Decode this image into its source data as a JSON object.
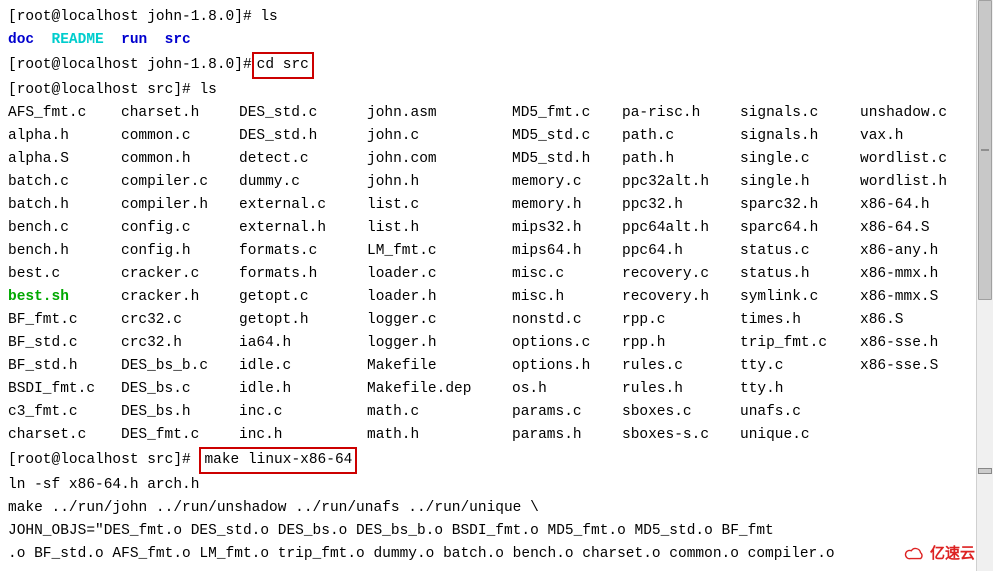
{
  "prompt1": "[root@localhost john-1.8.0]# ",
  "cmd_ls1": "ls",
  "dirline": {
    "doc": "doc",
    "readme": "README",
    "run": "run",
    "src": "src"
  },
  "prompt2": "[root@localhost john-1.8.0]#",
  "cmd_cd": " cd src      ",
  "prompt3": "[root@localhost src]# ",
  "cmd_ls2": "ls",
  "cols": [
    [
      {
        "t": "AFS_fmt.c"
      },
      {
        "t": "alpha.h"
      },
      {
        "t": "alpha.S"
      },
      {
        "t": "batch.c"
      },
      {
        "t": "batch.h"
      },
      {
        "t": "bench.c"
      },
      {
        "t": "bench.h"
      },
      {
        "t": "best.c"
      },
      {
        "t": "best.sh",
        "cls": "green"
      },
      {
        "t": "BF_fmt.c"
      },
      {
        "t": "BF_std.c"
      },
      {
        "t": "BF_std.h"
      },
      {
        "t": "BSDI_fmt.c"
      },
      {
        "t": "c3_fmt.c"
      },
      {
        "t": "charset.c"
      }
    ],
    [
      {
        "t": "charset.h"
      },
      {
        "t": "common.c"
      },
      {
        "t": "common.h"
      },
      {
        "t": "compiler.c"
      },
      {
        "t": "compiler.h"
      },
      {
        "t": "config.c"
      },
      {
        "t": "config.h"
      },
      {
        "t": "cracker.c"
      },
      {
        "t": "cracker.h"
      },
      {
        "t": "crc32.c"
      },
      {
        "t": "crc32.h"
      },
      {
        "t": "DES_bs_b.c"
      },
      {
        "t": "DES_bs.c"
      },
      {
        "t": "DES_bs.h"
      },
      {
        "t": "DES_fmt.c"
      }
    ],
    [
      {
        "t": "DES_std.c"
      },
      {
        "t": "DES_std.h"
      },
      {
        "t": "detect.c"
      },
      {
        "t": "dummy.c"
      },
      {
        "t": "external.c"
      },
      {
        "t": "external.h"
      },
      {
        "t": "formats.c"
      },
      {
        "t": "formats.h"
      },
      {
        "t": "getopt.c"
      },
      {
        "t": "getopt.h"
      },
      {
        "t": "ia64.h"
      },
      {
        "t": "idle.c"
      },
      {
        "t": "idle.h"
      },
      {
        "t": "inc.c"
      },
      {
        "t": "inc.h"
      }
    ],
    [
      {
        "t": "john.asm"
      },
      {
        "t": "john.c"
      },
      {
        "t": "john.com"
      },
      {
        "t": "john.h"
      },
      {
        "t": "list.c"
      },
      {
        "t": "list.h"
      },
      {
        "t": "LM_fmt.c"
      },
      {
        "t": "loader.c"
      },
      {
        "t": "loader.h"
      },
      {
        "t": "logger.c"
      },
      {
        "t": "logger.h"
      },
      {
        "t": "Makefile"
      },
      {
        "t": "Makefile.dep"
      },
      {
        "t": "math.c"
      },
      {
        "t": "math.h"
      }
    ],
    [
      {
        "t": "MD5_fmt.c"
      },
      {
        "t": "MD5_std.c"
      },
      {
        "t": "MD5_std.h"
      },
      {
        "t": "memory.c"
      },
      {
        "t": "memory.h"
      },
      {
        "t": "mips32.h"
      },
      {
        "t": "mips64.h"
      },
      {
        "t": "misc.c"
      },
      {
        "t": "misc.h"
      },
      {
        "t": "nonstd.c"
      },
      {
        "t": "options.c"
      },
      {
        "t": "options.h"
      },
      {
        "t": "os.h"
      },
      {
        "t": "params.c"
      },
      {
        "t": "params.h"
      }
    ],
    [
      {
        "t": "pa-risc.h"
      },
      {
        "t": "path.c"
      },
      {
        "t": "path.h"
      },
      {
        "t": "ppc32alt.h"
      },
      {
        "t": "ppc32.h"
      },
      {
        "t": "ppc64alt.h"
      },
      {
        "t": "ppc64.h"
      },
      {
        "t": "recovery.c"
      },
      {
        "t": "recovery.h"
      },
      {
        "t": "rpp.c"
      },
      {
        "t": "rpp.h"
      },
      {
        "t": "rules.c"
      },
      {
        "t": "rules.h"
      },
      {
        "t": "sboxes.c"
      },
      {
        "t": "sboxes-s.c"
      }
    ],
    [
      {
        "t": "signals.c"
      },
      {
        "t": "signals.h"
      },
      {
        "t": "single.c"
      },
      {
        "t": "single.h"
      },
      {
        "t": "sparc32.h"
      },
      {
        "t": "sparc64.h"
      },
      {
        "t": "status.c"
      },
      {
        "t": "status.h"
      },
      {
        "t": "symlink.c"
      },
      {
        "t": "times.h"
      },
      {
        "t": "trip_fmt.c"
      },
      {
        "t": "tty.c"
      },
      {
        "t": "tty.h"
      },
      {
        "t": "unafs.c"
      },
      {
        "t": "unique.c"
      }
    ],
    [
      {
        "t": "unshadow.c"
      },
      {
        "t": "vax.h"
      },
      {
        "t": "wordlist.c"
      },
      {
        "t": "wordlist.h"
      },
      {
        "t": "x86-64.h"
      },
      {
        "t": "x86-64.S"
      },
      {
        "t": "x86-any.h"
      },
      {
        "t": "x86-mmx.h"
      },
      {
        "t": "x86-mmx.S"
      },
      {
        "t": "x86.S"
      },
      {
        "t": "x86-sse.h"
      },
      {
        "t": "x86-sse.S"
      }
    ]
  ],
  "prompt4": "[root@localhost src]# ",
  "cmd_make": "make linux-x86-64",
  "out1": "ln -sf x86-64.h arch.h",
  "out2": "make ../run/john ../run/unshadow ../run/unafs ../run/unique \\",
  "out3": "        JOHN_OBJS=\"DES_fmt.o DES_std.o DES_bs.o DES_bs_b.o BSDI_fmt.o MD5_fmt.o MD5_std.o BF_fmt",
  "out4": ".o BF_std.o AFS_fmt.o LM_fmt.o trip_fmt.o dummy.o batch.o bench.o charset.o common.o compiler.o",
  "watermark": "亿速云"
}
